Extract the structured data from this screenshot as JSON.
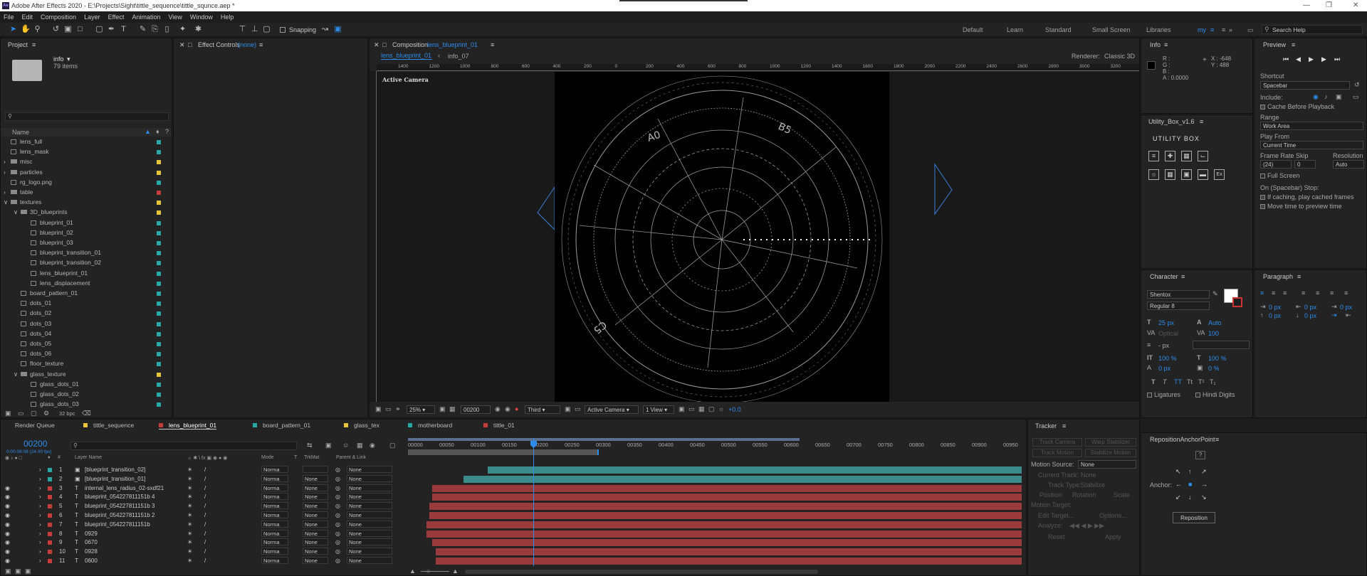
{
  "window": {
    "title": "Adobe After Effects 2020 - E:\\Projects\\Sight\\tittle_sequence\\tittle_squnce.aep *",
    "logo": "Ae"
  },
  "menu": [
    "File",
    "Edit",
    "Composition",
    "Layer",
    "Effect",
    "Animation",
    "View",
    "Window",
    "Help"
  ],
  "toolbar": {
    "snapping_label": "Snapping",
    "search_placeholder": "Search Help"
  },
  "workspaces": [
    "Default",
    "Learn",
    "Standard",
    "Small Screen",
    "Libraries",
    "my"
  ],
  "project": {
    "tab": "Project",
    "info_name": "info",
    "info_count": "79 items",
    "name_header": "Name",
    "bpc": "32 bpc",
    "items": [
      {
        "name": "lens_full",
        "indent": 1,
        "type": "file",
        "color": "#2aa8a8"
      },
      {
        "name": "lens_mask",
        "indent": 1,
        "type": "file",
        "color": "#2aa8a8"
      },
      {
        "name": "misc",
        "indent": 1,
        "type": "folder",
        "color": "#e6c43c"
      },
      {
        "name": "particles",
        "indent": 1,
        "type": "folder",
        "color": "#e6c43c"
      },
      {
        "name": "rg_logo.png",
        "indent": 1,
        "type": "file",
        "color": "#2aa8a8"
      },
      {
        "name": "table",
        "indent": 1,
        "type": "folder",
        "color": "#c83c3c"
      },
      {
        "name": "textures",
        "indent": 1,
        "type": "folder",
        "color": "#e6c43c"
      },
      {
        "name": "3D_blueprints",
        "indent": 2,
        "type": "folder",
        "color": "#e6c43c"
      },
      {
        "name": "blueprint_01",
        "indent": 3,
        "type": "file",
        "color": "#2aa8a8"
      },
      {
        "name": "blueprint_02",
        "indent": 3,
        "type": "file",
        "color": "#2aa8a8"
      },
      {
        "name": "blueprint_03",
        "indent": 3,
        "type": "file",
        "color": "#2aa8a8"
      },
      {
        "name": "blueprint_transition_01",
        "indent": 3,
        "type": "file",
        "color": "#2aa8a8"
      },
      {
        "name": "blueprint_transition_02",
        "indent": 3,
        "type": "file",
        "color": "#2aa8a8"
      },
      {
        "name": "lens_blueprint_01",
        "indent": 3,
        "type": "file",
        "color": "#2aa8a8"
      },
      {
        "name": "lens_displacement",
        "indent": 3,
        "type": "file",
        "color": "#2aa8a8"
      },
      {
        "name": "board_pattern_01",
        "indent": 2,
        "type": "file",
        "color": "#2aa8a8"
      },
      {
        "name": "dots_01",
        "indent": 2,
        "type": "file",
        "color": "#2aa8a8"
      },
      {
        "name": "dots_02",
        "indent": 2,
        "type": "file",
        "color": "#2aa8a8"
      },
      {
        "name": "dots_03",
        "indent": 2,
        "type": "file",
        "color": "#2aa8a8"
      },
      {
        "name": "dots_04",
        "indent": 2,
        "type": "file",
        "color": "#2aa8a8"
      },
      {
        "name": "dots_05",
        "indent": 2,
        "type": "file",
        "color": "#2aa8a8"
      },
      {
        "name": "dots_06",
        "indent": 2,
        "type": "file",
        "color": "#2aa8a8"
      },
      {
        "name": "floor_texture",
        "indent": 2,
        "type": "file",
        "color": "#2aa8a8"
      },
      {
        "name": "glass_texture",
        "indent": 2,
        "type": "folder",
        "color": "#e6c43c"
      },
      {
        "name": "glass_dots_01",
        "indent": 3,
        "type": "file",
        "color": "#2aa8a8"
      },
      {
        "name": "glass_dots_02",
        "indent": 3,
        "type": "file",
        "color": "#2aa8a8"
      },
      {
        "name": "glass_dots_03",
        "indent": 3,
        "type": "file",
        "color": "#2aa8a8"
      }
    ]
  },
  "effect_controls": {
    "tab": "Effect Controls",
    "value": "(none)"
  },
  "composition": {
    "tab": "Composition",
    "name": "lens_blueprint_01",
    "subtabs": [
      "lens_blueprint_01",
      "info_07"
    ],
    "renderer_label": "Renderer:",
    "renderer": "Classic 3D",
    "active_camera_label": "Active Camera",
    "zoom": "25%",
    "timecode": "00200",
    "resolution": "Third",
    "view": "Active Camera",
    "views": "1 View",
    "exposure": "+0.0",
    "ruler": [
      "1400",
      "1200",
      "1000",
      "800",
      "600",
      "400",
      "200",
      "0",
      "200",
      "400",
      "600",
      "800",
      "1000",
      "1200",
      "1400",
      "1600",
      "1800",
      "2000",
      "2200",
      "2400",
      "2600",
      "2800",
      "3000",
      "3200"
    ],
    "labels": [
      "A0",
      "B5",
      "C5"
    ]
  },
  "info": {
    "tab": "Info",
    "r": "R :",
    "g": "G :",
    "b": "B :",
    "a": "A : 0.0000",
    "x": "X : -648",
    "y": "Y : 488"
  },
  "utility": {
    "tab": "Utility_Box_v1.6",
    "title": "UTILITY BOX"
  },
  "preview": {
    "tab": "Preview",
    "shortcut_label": "Shortcut",
    "shortcut": "Spacebar",
    "include_label": "Include:",
    "cache_label": "Cache Before Playback",
    "range_label": "Range",
    "range": "Work Area",
    "play_from_label": "Play From",
    "play_from": "Current Time",
    "frame_rate_label": "Frame Rate",
    "skip_label": "Skip",
    "resolution_label": "Resolution",
    "frame_rate": "(24)",
    "skip": "0",
    "resolution": "Auto",
    "full_screen": "Full Screen",
    "stop_label": "On (Spacebar) Stop:",
    "caching": "If caching, play cached frames",
    "move_time": "Move time to preview time"
  },
  "character": {
    "tab": "Character",
    "font": "Shentox",
    "style": "Regular 8",
    "size": "25 px",
    "leading": "Auto",
    "kerning": "Optical",
    "tracking": "100",
    "stroke": "- px",
    "vscale": "100 %",
    "hscale": "100 %",
    "baseline": "0 px",
    "tsume": "0 %",
    "ligatures": "Ligatures",
    "hindi": "Hindi Digits",
    "fill_color": "#ffffff"
  },
  "paragraph": {
    "tab": "Paragraph",
    "values": [
      "0 px",
      "0 px",
      "0 px",
      "0 px",
      "0 px"
    ]
  },
  "timeline": {
    "tabs": [
      {
        "name": "Render Queue",
        "color": ""
      },
      {
        "name": "tittle_sequence",
        "color": "#e6c43c"
      },
      {
        "name": "lens_blueprint_01",
        "color": "#c83c3c"
      },
      {
        "name": "board_pattern_01",
        "color": "#2aa8a8"
      },
      {
        "name": "glass_tex",
        "color": "#e6c43c"
      },
      {
        "name": "motherboard",
        "color": "#2aa8a8"
      },
      {
        "name": "tittle_01",
        "color": "#c83c3c"
      }
    ],
    "timecode": "00200",
    "timecode_sub": "0:00:08:08 (24.00 fps)",
    "headers": {
      "num": "#",
      "layer_name": "Layer Name",
      "mode": "Mode",
      "t": "T",
      "trkmat": "TrkMat",
      "parent": "Parent & Link"
    },
    "ruler": [
      "00000",
      "00050",
      "00100",
      "00150",
      "00200",
      "00250",
      "00300",
      "00350",
      "00400",
      "00450",
      "00500",
      "00550",
      "00600",
      "00650",
      "00700",
      "00750",
      "00800",
      "00850",
      "00900",
      "00950"
    ],
    "layers": [
      {
        "num": "1",
        "name": "[blueprint_transition_02]",
        "type": "footage",
        "color": "#2aa8a8",
        "mode": "Norma",
        "trk": "",
        "parent": "None",
        "start": 0.13,
        "bar": "#3d8a8a"
      },
      {
        "num": "2",
        "name": "[blueprint_transition_01]",
        "type": "footage",
        "color": "#2aa8a8",
        "mode": "Norma",
        "trk": "None",
        "parent": "None",
        "start": 0.09,
        "bar": "#3d8a8a"
      },
      {
        "num": "3",
        "name": "internal_lens_radius_02-sxdf21",
        "type": "text",
        "color": "#c83c3c",
        "mode": "Norma",
        "trk": "None",
        "parent": "None",
        "start": 0.04,
        "bar": "#9a3b3b"
      },
      {
        "num": "4",
        "name": "blueprint_054227811151b 4",
        "type": "text",
        "color": "#c83c3c",
        "mode": "Norma",
        "trk": "None",
        "parent": "None",
        "start": 0.04,
        "bar": "#9a3b3b"
      },
      {
        "num": "5",
        "name": "blueprint_054227811151b 3",
        "type": "text",
        "color": "#c83c3c",
        "mode": "Norma",
        "trk": "None",
        "parent": "None",
        "start": 0.035,
        "bar": "#9a3b3b"
      },
      {
        "num": "6",
        "name": "blueprint_054227811151b 2",
        "type": "text",
        "color": "#c83c3c",
        "mode": "Norma",
        "trk": "None",
        "parent": "None",
        "start": 0.035,
        "bar": "#9a3b3b"
      },
      {
        "num": "7",
        "name": "blueprint_054227811151b",
        "type": "text",
        "color": "#c83c3c",
        "mode": "Norma",
        "trk": "None",
        "parent": "None",
        "start": 0.03,
        "bar": "#9a3b3b"
      },
      {
        "num": "8",
        "name": "0929",
        "type": "text",
        "color": "#c83c3c",
        "mode": "Norma",
        "trk": "None",
        "parent": "None",
        "start": 0.03,
        "bar": "#9a3b3b"
      },
      {
        "num": "9",
        "name": "0670",
        "type": "text",
        "color": "#c83c3c",
        "mode": "Norma",
        "trk": "None",
        "parent": "None",
        "start": 0.04,
        "bar": "#9a3b3b"
      },
      {
        "num": "10",
        "name": "0928",
        "type": "text",
        "color": "#c83c3c",
        "mode": "Norma",
        "trk": "None",
        "parent": "None",
        "start": 0.045,
        "bar": "#9a3b3b"
      },
      {
        "num": "11",
        "name": "0600",
        "type": "text",
        "color": "#c83c3c",
        "mode": "Norma",
        "trk": "None",
        "parent": "None",
        "start": 0.045,
        "bar": "#9a3b3b"
      }
    ]
  },
  "tracker": {
    "tab": "Tracker",
    "track_camera": "Track Camera",
    "warp_stabilizer": "Warp Stabilizer",
    "track_motion": "Track Motion",
    "stabilize_motion": "Stabilize Motion",
    "motion_source_label": "Motion Source:",
    "motion_source": "None",
    "current_track_label": "Current Track:",
    "current_track": "None",
    "track_type_label": "Track Type:",
    "track_type": "Stabilize",
    "position": "Position",
    "rotation": "Rotation",
    "scale": "Scale",
    "motion_target": "Motion Target:",
    "edit_target": "Edit Target...",
    "options": "Options...",
    "analyze": "Analyze:",
    "reset": "Reset",
    "apply": "Apply"
  },
  "reposition": {
    "tab": "RepositionAnchorPoint",
    "help": "?",
    "anchor_label": "Anchor:",
    "button": "Reposition"
  }
}
